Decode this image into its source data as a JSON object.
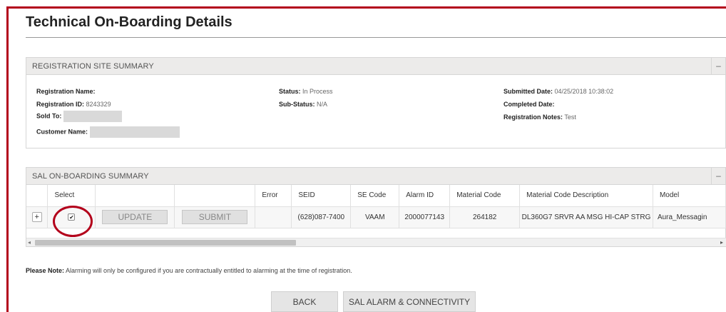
{
  "page": {
    "title": "Technical On-Boarding Details"
  },
  "registration_summary": {
    "header": "REGISTRATION SITE SUMMARY",
    "collapse_symbol": "–",
    "fields": {
      "registration_name": {
        "label": "Registration Name:",
        "value": ""
      },
      "registration_id": {
        "label": "Registration ID:",
        "value": "8243329"
      },
      "sold_to": {
        "label": "Sold To:",
        "value": ""
      },
      "customer_name": {
        "label": "Customer Name:",
        "value": ""
      },
      "status": {
        "label": "Status:",
        "value": "In Process"
      },
      "sub_status": {
        "label": "Sub-Status:",
        "value": "N/A"
      },
      "submitted_date": {
        "label": "Submitted Date:",
        "value": "04/25/2018 10:38:02"
      },
      "completed_date": {
        "label": "Completed Date:",
        "value": ""
      },
      "registration_notes": {
        "label": "Registration Notes:",
        "value": "Test"
      }
    }
  },
  "sal_summary": {
    "header": "SAL ON-BOARDING SUMMARY",
    "collapse_symbol": "–",
    "columns": [
      "",
      "Select",
      "",
      "",
      "Error",
      "SEID",
      "SE Code",
      "Alarm ID",
      "Material Code",
      "Material Code Description",
      "Model"
    ],
    "row": {
      "expand_symbol": "+",
      "checkbox_checked": true,
      "checkbox_glyph": "✔",
      "update_label": "UPDATE",
      "submit_label": "SUBMIT",
      "error": "",
      "seid": "(628)087-7400",
      "se_code": "VAAM",
      "alarm_id": "2000077143",
      "material_code": "264182",
      "material_code_description": "DL360G7 SRVR AA MSG HI-CAP STRG",
      "model": "Aura_Messagin"
    },
    "scroll_left": "◂",
    "scroll_right": "▸"
  },
  "note": {
    "label": "Please Note:",
    "text": "Alarming will only be configured if you are contractually entitled to alarming at the time of registration."
  },
  "buttons": {
    "back": "BACK",
    "sal_alarm": "SAL ALARM & CONNECTIVITY"
  },
  "colors": {
    "accent_red": "#b3001b",
    "header_gray": "#ecebea"
  }
}
